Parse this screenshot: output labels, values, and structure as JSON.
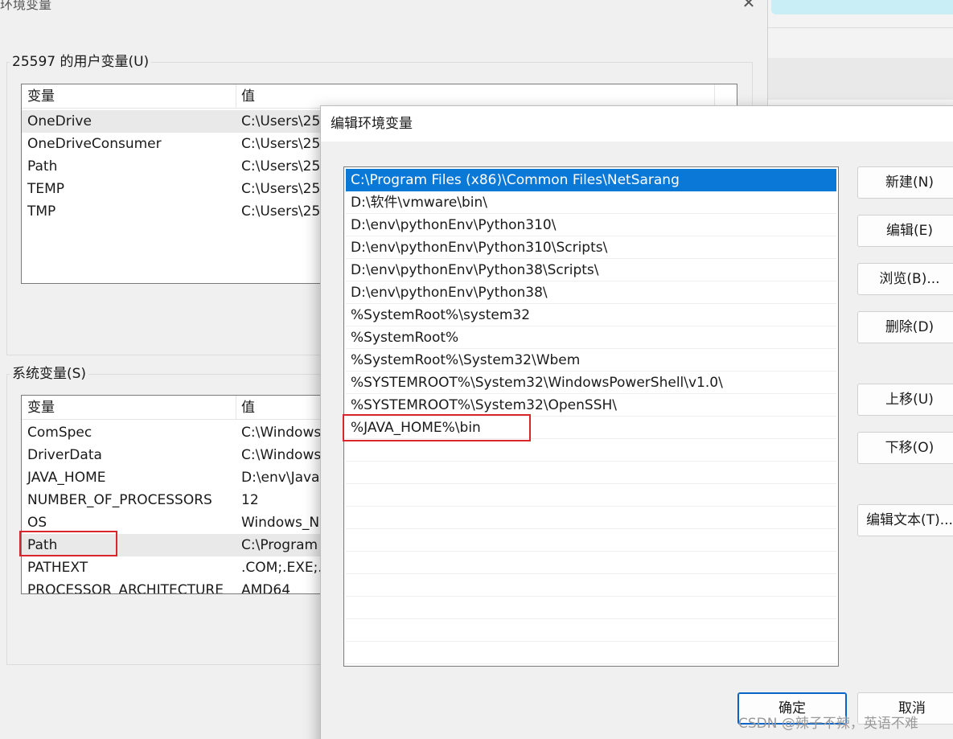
{
  "env_window": {
    "title": "环境变量",
    "close_glyph": "✕",
    "user_group": {
      "legend": "25597 的用户变量(U)",
      "columns": [
        "变量",
        "值"
      ],
      "rows": [
        {
          "name": "OneDrive",
          "value": "C:\\Users\\25"
        },
        {
          "name": "OneDriveConsumer",
          "value": "C:\\Users\\25"
        },
        {
          "name": "Path",
          "value": "C:\\Users\\25"
        },
        {
          "name": "TEMP",
          "value": "C:\\Users\\25"
        },
        {
          "name": "TMP",
          "value": "C:\\Users\\25"
        }
      ]
    },
    "system_group": {
      "legend": "系统变量(S)",
      "columns": [
        "变量",
        "值"
      ],
      "rows": [
        {
          "name": "ComSpec",
          "value": "C:\\Windows"
        },
        {
          "name": "DriverData",
          "value": "C:\\Windows"
        },
        {
          "name": "JAVA_HOME",
          "value": "D:\\env\\Java"
        },
        {
          "name": "NUMBER_OF_PROCESSORS",
          "value": "12"
        },
        {
          "name": "OS",
          "value": "Windows_N"
        },
        {
          "name": "Path",
          "value": "C:\\Program"
        },
        {
          "name": "PATHEXT",
          "value": ".COM;.EXE;."
        },
        {
          "name": "PROCESSOR_ARCHITECTURE",
          "value": "AMD64"
        }
      ]
    }
  },
  "edit_window": {
    "title": "编辑环境变量",
    "paths": [
      "C:\\Program Files (x86)\\Common Files\\NetSarang",
      "D:\\软件\\vmware\\bin\\",
      "D:\\env\\pythonEnv\\Python310\\",
      "D:\\env\\pythonEnv\\Python310\\Scripts\\",
      "D:\\env\\pythonEnv\\Python38\\Scripts\\",
      "D:\\env\\pythonEnv\\Python38\\",
      "%SystemRoot%\\system32",
      "%SystemRoot%",
      "%SystemRoot%\\System32\\Wbem",
      "%SYSTEMROOT%\\System32\\WindowsPowerShell\\v1.0\\",
      "%SYSTEMROOT%\\System32\\OpenSSH\\",
      "%JAVA_HOME%\\bin"
    ],
    "buttons": {
      "new": "新建(N)",
      "edit": "编辑(E)",
      "browse": "浏览(B)...",
      "delete": "删除(D)",
      "move_up": "上移(U)",
      "move_down": "下移(O)",
      "edit_text": "编辑文本(T)...",
      "ok": "确定",
      "cancel": "取消"
    }
  },
  "watermark": "CSDN @辣子不辣，英语不难",
  "colors": {
    "selection": "#0a78d7",
    "highlight_box": "#d9262e"
  }
}
